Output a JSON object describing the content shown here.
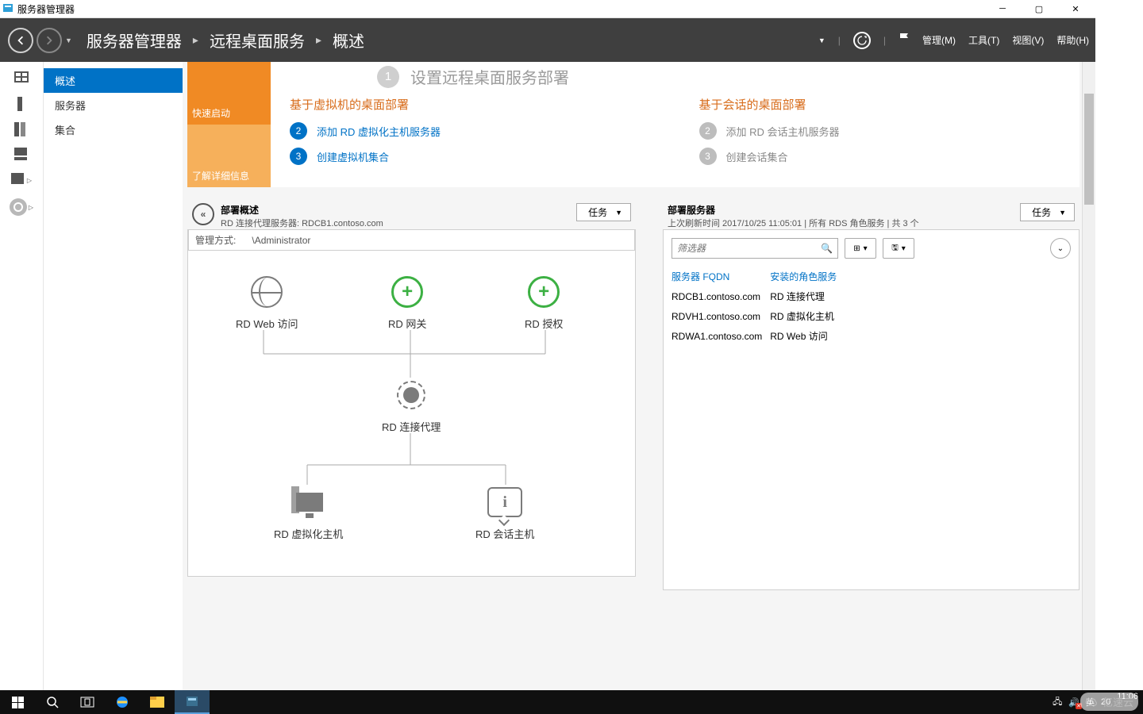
{
  "window": {
    "title": "服务器管理器"
  },
  "breadcrumb": {
    "a": "服务器管理器",
    "b": "远程桌面服务",
    "c": "概述"
  },
  "menus": {
    "manage": "管理(M)",
    "tools": "工具(T)",
    "view": "视图(V)",
    "help": "帮助(H)"
  },
  "sidebar": {
    "items": [
      "概述",
      "服务器",
      "集合"
    ],
    "active": 0
  },
  "tiles": {
    "quick": "快速启动",
    "learn": "了解详细信息"
  },
  "setup": {
    "heading_num": "1",
    "heading": "设置远程桌面服务部署",
    "col1": {
      "title": "基于虚拟机的桌面部署",
      "steps": [
        {
          "num": "2",
          "label": "添加 RD 虚拟化主机服务器",
          "state": "active"
        },
        {
          "num": "3",
          "label": "创建虚拟机集合",
          "state": "active"
        }
      ]
    },
    "col2": {
      "title": "基于会话的桌面部署",
      "steps": [
        {
          "num": "2",
          "label": "添加 RD 会话主机服务器",
          "state": "disabled"
        },
        {
          "num": "3",
          "label": "创建会话集合",
          "state": "disabled"
        }
      ]
    }
  },
  "overview": {
    "title": "部署概述",
    "sub_prefix": "RD 连接代理服务器: ",
    "sub_host": "RDCB1.contoso.com",
    "tasks": "任务",
    "admin_label": "管理方式:",
    "admin_value": "\\Administrator",
    "nodes": {
      "web": "RD Web 访问",
      "gw": "RD 网关",
      "lic": "RD 授权",
      "broker": "RD 连接代理",
      "vhost": "RD 虚拟化主机",
      "shost": "RD 会话主机"
    }
  },
  "servers": {
    "title": "部署服务器",
    "sub": "上次刷新时间 2017/10/25 11:05:01 | 所有 RDS 角色服务  | 共 3 个",
    "tasks": "任务",
    "filter_placeholder": "筛选器",
    "cols": {
      "fqdn": "服务器 FQDN",
      "role": "安装的角色服务"
    },
    "rows": [
      {
        "fqdn": "RDCB1.contoso.com",
        "role": "RD 连接代理"
      },
      {
        "fqdn": "RDVH1.contoso.com",
        "role": "RD 虚拟化主机"
      },
      {
        "fqdn": "RDWA1.contoso.com",
        "role": "RD Web 访问"
      }
    ]
  },
  "taskbar": {
    "ime": "英",
    "year": "20",
    "time": "11:06"
  },
  "watermark": "亿速云"
}
